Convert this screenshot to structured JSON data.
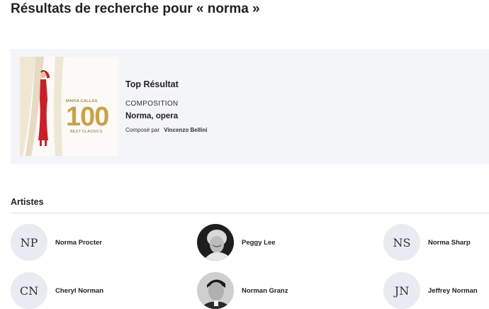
{
  "header": {
    "title": "Résultats de recherche pour « norma »"
  },
  "top_result": {
    "label": "Top Résultat",
    "type": "COMPOSITION",
    "title": "Norma, opera",
    "composer_prefix": "Composé par",
    "composer": "Vincenzo Bellini",
    "cover": {
      "artist_first": "MARIA",
      "artist_last": "CALLAS",
      "number": "100",
      "subtitle": "BEST CLASSICS"
    }
  },
  "artists_section": {
    "title": "Artistes",
    "items": [
      {
        "initials": "NP",
        "name": "Norma Procter",
        "photo": false
      },
      {
        "initials": "",
        "name": "Peggy Lee",
        "photo": true
      },
      {
        "initials": "NS",
        "name": "Norma Sharp",
        "photo": false
      },
      {
        "initials": "CN",
        "name": "Cheryl Norman",
        "photo": false
      },
      {
        "initials": "",
        "name": "Norman Granz",
        "photo": true
      },
      {
        "initials": "JN",
        "name": "Jeffrey Norman",
        "photo": false
      }
    ]
  },
  "colors": {
    "card_bg": "#f4f5f9",
    "avatar_bg": "#e8ebf2",
    "cover_gold": "#c9a24b",
    "dress_red": "#c8202a"
  }
}
